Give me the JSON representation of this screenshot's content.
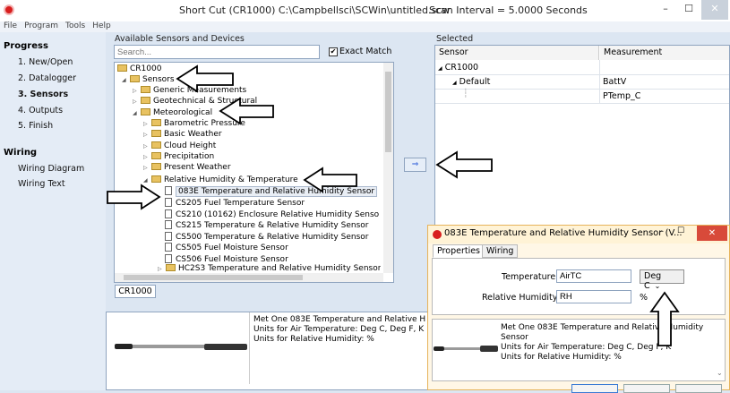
{
  "window": {
    "title": "Short Cut (CR1000) C:\\Campbellsci\\SCWin\\untitled.scw",
    "scan_interval": "Scan Interval = 5.0000 Seconds",
    "min_label": "–",
    "max_label": "☐",
    "close_label": "✕"
  },
  "menu": [
    "File",
    "Program",
    "Tools",
    "Help"
  ],
  "nav": {
    "progress_heading": "Progress",
    "progress_items": [
      "1. New/Open",
      "2. Datalogger",
      "3. Sensors",
      "4. Outputs",
      "5. Finish"
    ],
    "wiring_heading": "Wiring",
    "wiring_items": [
      "Wiring Diagram",
      "Wiring Text"
    ]
  },
  "available": {
    "label": "Available Sensors and Devices",
    "search_placeholder": "Search...",
    "exact_match_label": "Exact Match",
    "exact_match_checked": true,
    "tree": [
      "CR1000",
      "Sensors",
      "Generic Measurements",
      "Geotechnical & Structural",
      "Meteorological",
      "Barometric Pressure",
      "Basic Weather",
      "Cloud Height",
      "Precipitation",
      "Present Weather",
      "Relative Humidity & Temperature",
      "083E Temperature and Relative Humidity Sensor",
      "CS205 Fuel Temperature Sensor",
      "CS210 (10162) Enclosure Relative Humidity Senso",
      "CS215 Temperature & Relative Humidity Sensor",
      "CS500 Temperature & Relative Humidity Sensor",
      "CS505 Fuel Moisture Sensor",
      "CS506 Fuel Moisture Sensor",
      "HC2S3 Temperature and Relative Humidity Sensor"
    ],
    "tab_label": "CR1000"
  },
  "description": {
    "line1": "Met One 083E Temperature and Relative H",
    "line2": "Units for Air Temperature: Deg C, Deg F, K",
    "line3": "Units for Relative Humidity: %"
  },
  "add_button": "⇒",
  "selected": {
    "label": "Selected",
    "col_sensor": "Sensor",
    "col_measurement": "Measurement",
    "rows": [
      {
        "sensor": "CR1000",
        "measurement": ""
      },
      {
        "sensor": "Default",
        "measurement": "BattV"
      },
      {
        "sensor": "",
        "measurement": "PTemp_C"
      }
    ]
  },
  "dialog": {
    "title": "083E Temperature and Relative Humidity Sensor (V...",
    "tabs": [
      "Properties",
      "Wiring"
    ],
    "temperature_label": "Temperature",
    "temperature_value": "AirTC",
    "temperature_unit": "Deg C",
    "rh_label": "Relative Humidity",
    "rh_value": "RH",
    "rh_unit": "%",
    "desc_line1": "Met One 083E Temperature and Relative Humidity",
    "desc_line2": "Sensor",
    "desc_line3": "Units for Air Temperature: Deg C, Deg F, K",
    "desc_line4": "Units for Relative Humidity: %"
  },
  "icons": {
    "app": "campbell-logo-icon",
    "folder": "folder-icon",
    "file": "document-icon",
    "arrow": "outline-arrow-annotation"
  },
  "colors": {
    "background": "#dce6f2",
    "dialog_bg": "#fff7e6",
    "close_red": "#d84a3a"
  }
}
